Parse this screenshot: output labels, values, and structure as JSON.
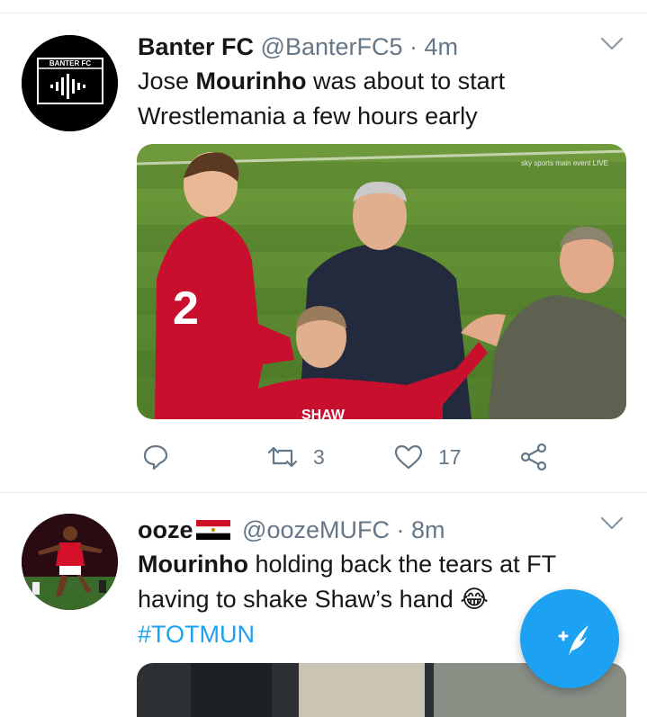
{
  "feed": {
    "tweets": [
      {
        "avatar_label": "BANTER FC",
        "name": "Banter FC",
        "handle": "@BanterFC5",
        "separator": "·",
        "time": "4m",
        "text_before": "Jose ",
        "text_bold": "Mourinho",
        "text_after": " was about to start Wrestlemania a few hours early",
        "media_overlay": "sky sports main event LIVE",
        "media_shirt_number": "2",
        "media_shirt_name": "SHAW",
        "actions": {
          "reply_count": "",
          "retweet_count": "3",
          "like_count": "17"
        }
      },
      {
        "name": "ooze",
        "handle": "@oozeMUFC",
        "separator": "·",
        "time": "8m",
        "text_bold": "Mourinho",
        "text_after": " holding back the tears at FT having to shake Shaw’s hand 😂",
        "hashtag": "#TOTMUN"
      }
    ]
  },
  "colors": {
    "accent": "#1da1f2",
    "secondary_text": "#657786",
    "divider": "#e6ecf0"
  },
  "icons": {
    "reply": "reply-icon",
    "retweet": "retweet-icon",
    "like": "heart-icon",
    "share": "share-icon",
    "more": "chevron-down-icon",
    "compose": "compose-tweet-icon"
  }
}
